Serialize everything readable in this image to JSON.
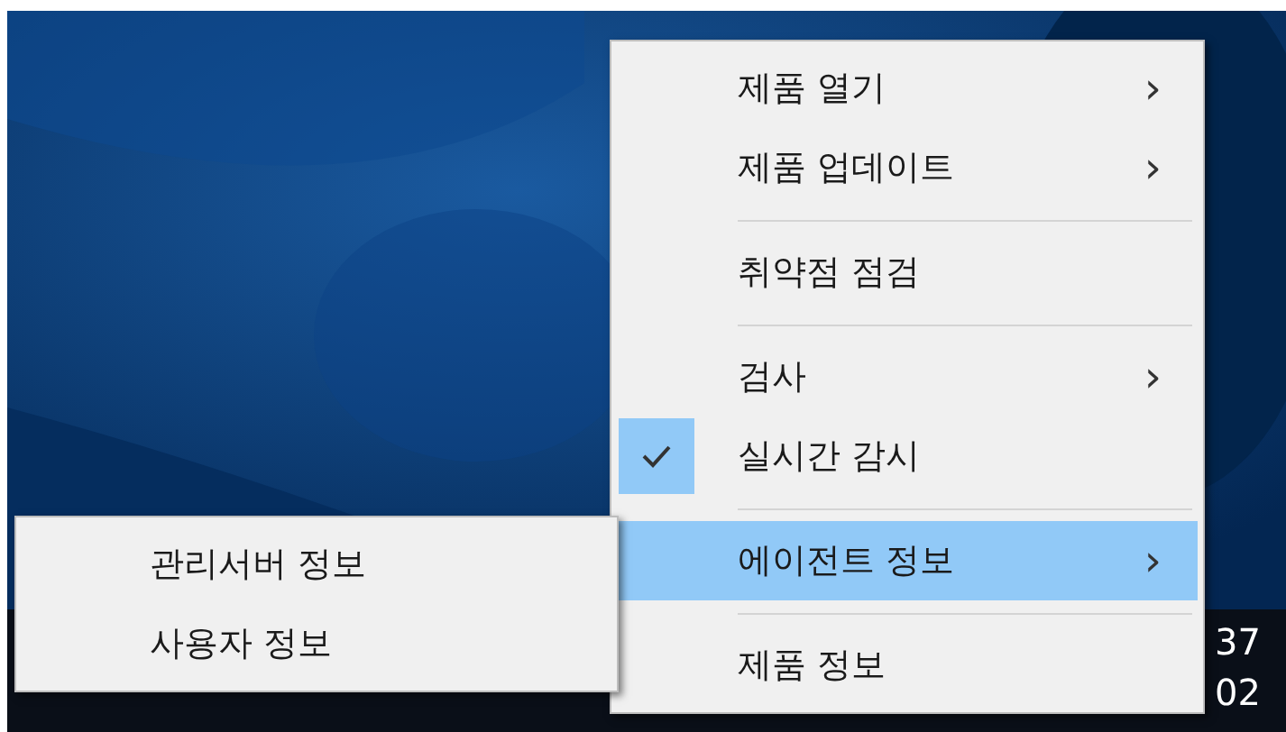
{
  "context_menu": {
    "items": [
      {
        "kind": "item",
        "label": "제품 열기",
        "submenu_arrow": "›",
        "checked": false,
        "selected": false
      },
      {
        "kind": "item",
        "label": "제품 업데이트",
        "submenu_arrow": "›",
        "checked": false,
        "selected": false
      },
      {
        "kind": "separator"
      },
      {
        "kind": "item",
        "label": "취약점 점검",
        "checked": false,
        "selected": false
      },
      {
        "kind": "separator"
      },
      {
        "kind": "item",
        "label": "검사",
        "submenu_arrow": "›",
        "checked": false,
        "selected": false
      },
      {
        "kind": "item",
        "label": "실시간 감시",
        "checked": true,
        "selected": false
      },
      {
        "kind": "separator"
      },
      {
        "kind": "item",
        "label": "에이전트 정보",
        "submenu_arrow": "›",
        "checked": false,
        "selected": true
      },
      {
        "kind": "separator"
      },
      {
        "kind": "item",
        "label": "제품 정보",
        "checked": false,
        "selected": false
      }
    ]
  },
  "submenu": {
    "items": [
      {
        "label": "관리서버 정보"
      },
      {
        "label": "사용자 정보"
      }
    ]
  },
  "taskbar": {
    "clock": [
      "37",
      "02"
    ]
  }
}
